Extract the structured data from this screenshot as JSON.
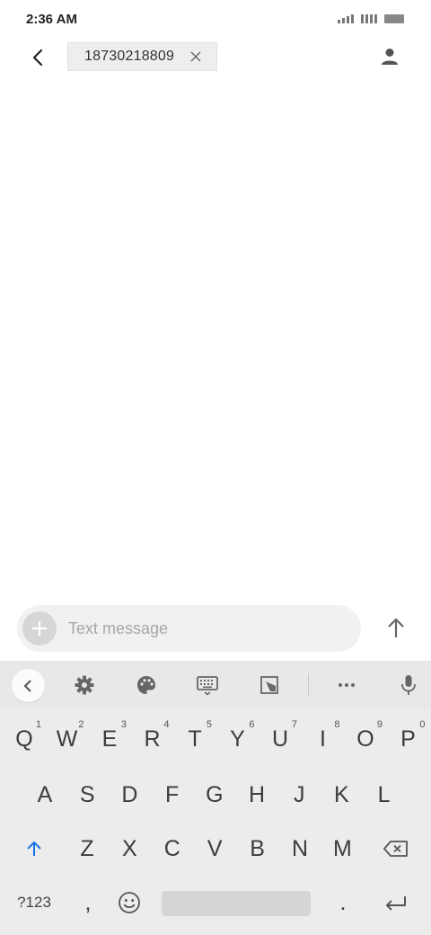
{
  "status_bar": {
    "time": "2:36 AM"
  },
  "header": {
    "recipient": "18730218809"
  },
  "compose": {
    "placeholder": "Text message"
  },
  "keyboard": {
    "row1": [
      {
        "label": "Q",
        "hint": "1"
      },
      {
        "label": "W",
        "hint": "2"
      },
      {
        "label": "E",
        "hint": "3"
      },
      {
        "label": "R",
        "hint": "4"
      },
      {
        "label": "T",
        "hint": "5"
      },
      {
        "label": "Y",
        "hint": "6"
      },
      {
        "label": "U",
        "hint": "7"
      },
      {
        "label": "I",
        "hint": "8"
      },
      {
        "label": "O",
        "hint": "9"
      },
      {
        "label": "P",
        "hint": "0"
      }
    ],
    "row2": [
      "A",
      "S",
      "D",
      "F",
      "G",
      "H",
      "J",
      "K",
      "L"
    ],
    "row3": [
      "Z",
      "X",
      "C",
      "V",
      "B",
      "N",
      "M"
    ],
    "row4": {
      "symbols": "?123",
      "comma": ",",
      "period": "."
    }
  },
  "colors": {
    "shift_accent": "#1a73e8",
    "keyboard_bg": "#ececec",
    "compose_bg": "#f1f1f1"
  }
}
